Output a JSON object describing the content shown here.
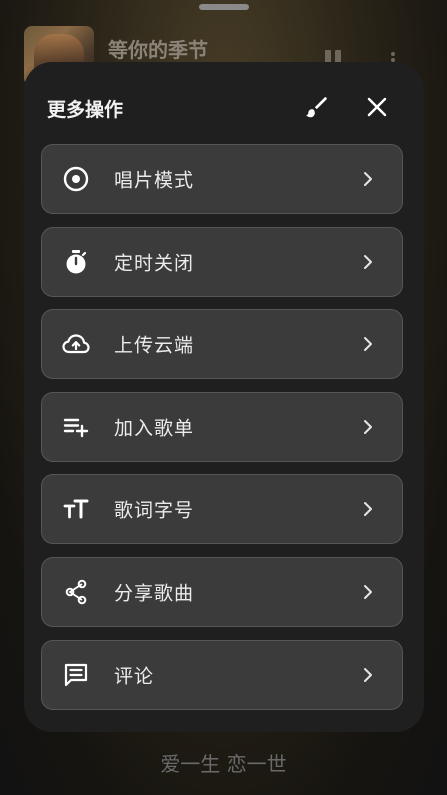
{
  "background": {
    "song_title": "等你的季节",
    "lyric": "爱一生 恋一世"
  },
  "sheet": {
    "title": "更多操作",
    "brush_icon": "brush-icon",
    "close_icon": "close-icon",
    "items": [
      {
        "label": "唱片模式",
        "icon": "vinyl-record-icon"
      },
      {
        "label": "定时关闭",
        "icon": "stopwatch-icon"
      },
      {
        "label": "上传云端",
        "icon": "cloud-upload-icon"
      },
      {
        "label": "加入歌单",
        "icon": "playlist-add-icon"
      },
      {
        "label": "歌词字号",
        "icon": "text-size-icon"
      },
      {
        "label": "分享歌曲",
        "icon": "share-icon"
      },
      {
        "label": "评论",
        "icon": "comment-icon"
      }
    ]
  },
  "colors": {
    "sheet_bg": "#1f1f1f",
    "item_bg": "#3b3b3b",
    "item_border": "#565656",
    "text": "#ececec"
  }
}
